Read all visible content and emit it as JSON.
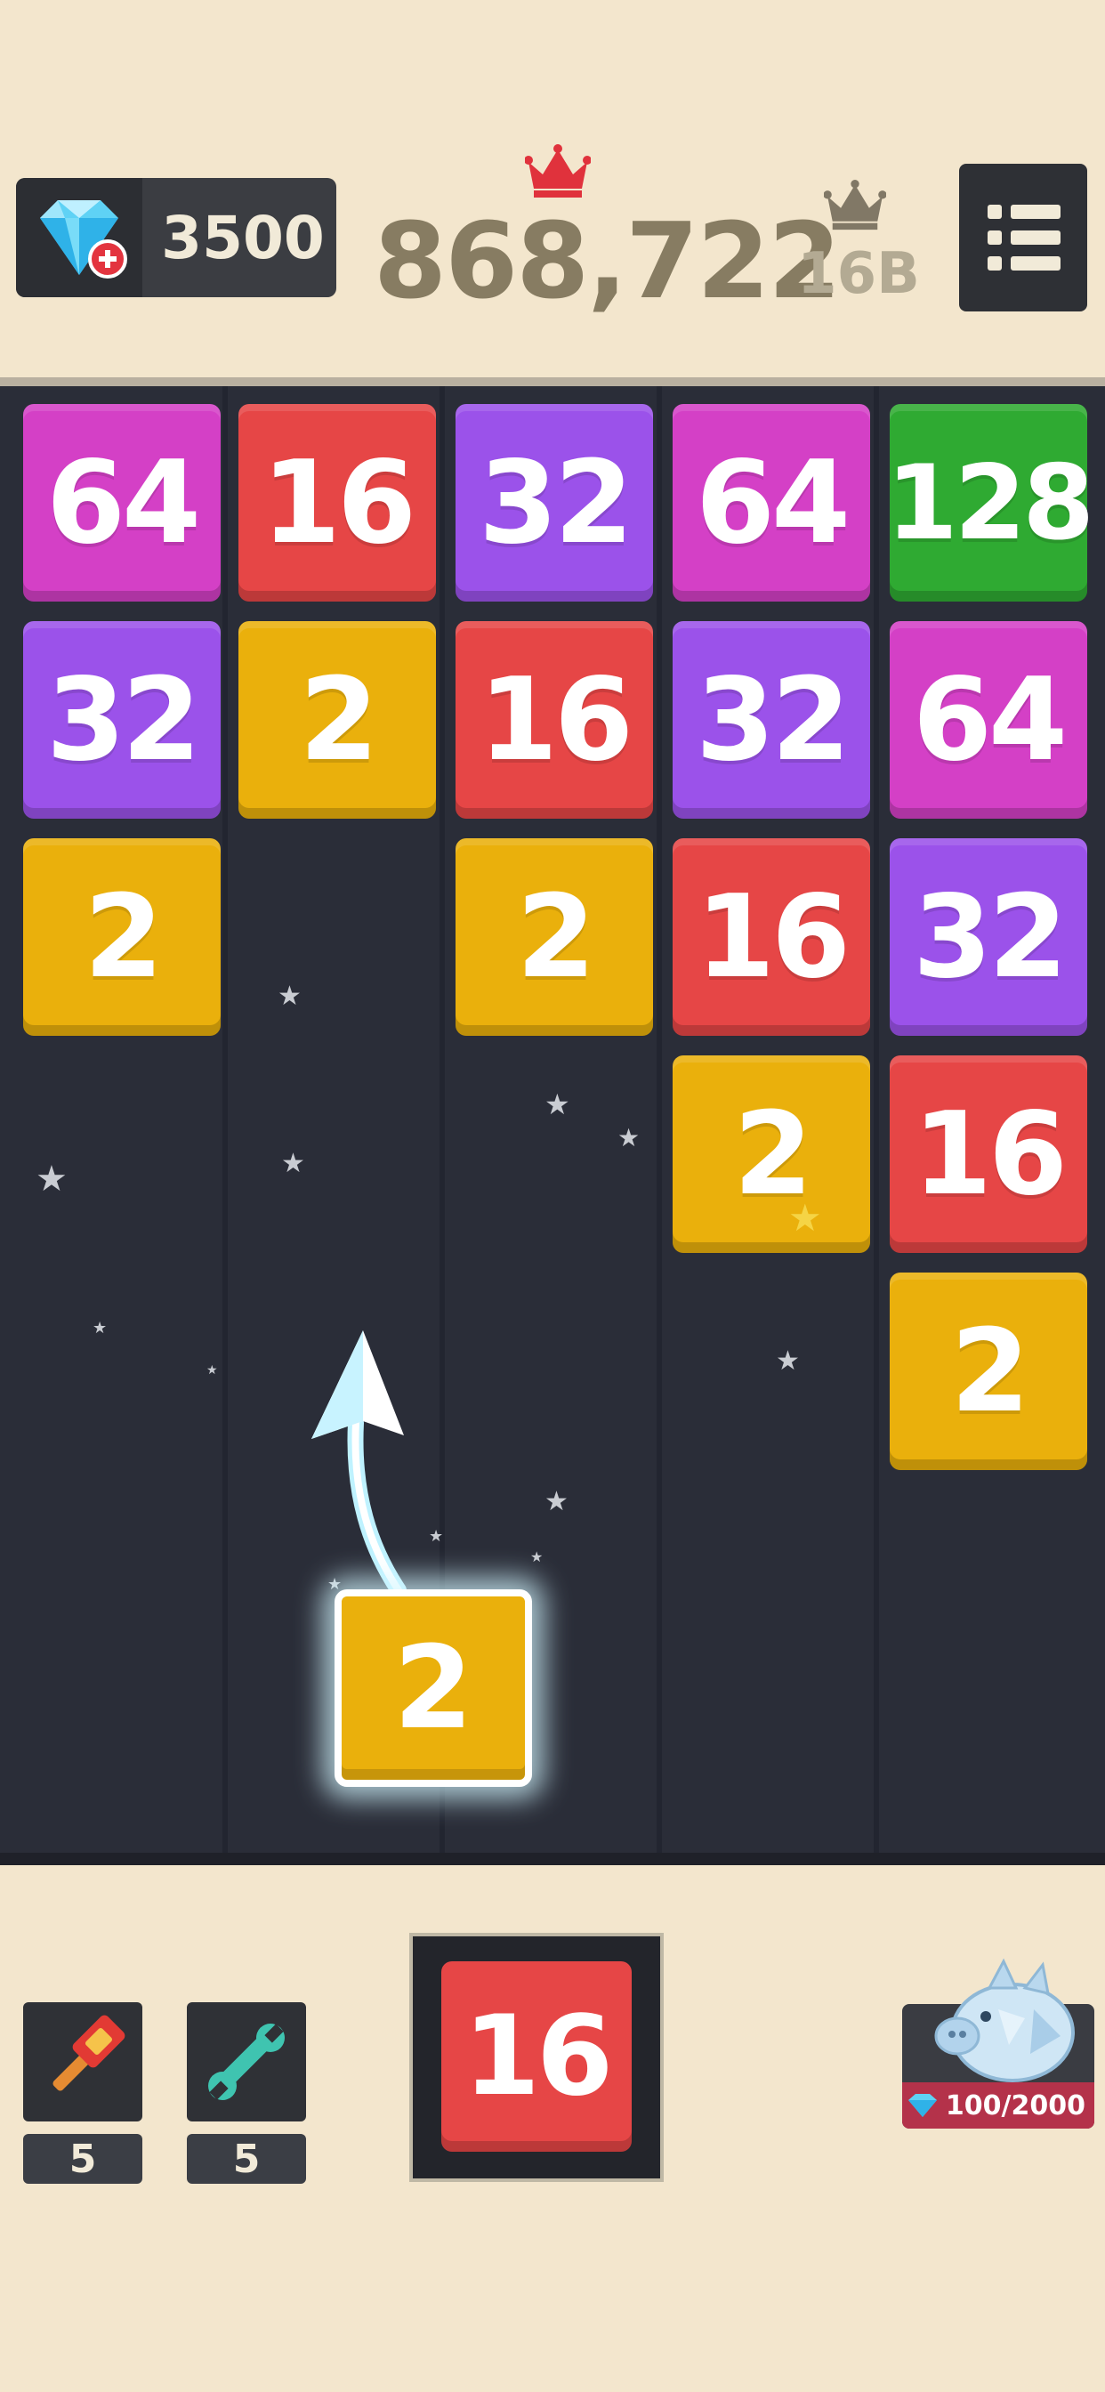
{
  "header": {
    "gems": "3500",
    "score": "868,722",
    "best": "16B"
  },
  "board": {
    "columns": 5,
    "tiles": [
      {
        "col": 0,
        "row": 0,
        "value": "64"
      },
      {
        "col": 1,
        "row": 0,
        "value": "16"
      },
      {
        "col": 2,
        "row": 0,
        "value": "32"
      },
      {
        "col": 3,
        "row": 0,
        "value": "64"
      },
      {
        "col": 4,
        "row": 0,
        "value": "128"
      },
      {
        "col": 0,
        "row": 1,
        "value": "32"
      },
      {
        "col": 1,
        "row": 1,
        "value": "2"
      },
      {
        "col": 2,
        "row": 1,
        "value": "16"
      },
      {
        "col": 3,
        "row": 1,
        "value": "32"
      },
      {
        "col": 4,
        "row": 1,
        "value": "64"
      },
      {
        "col": 0,
        "row": 2,
        "value": "2"
      },
      {
        "col": 2,
        "row": 2,
        "value": "2"
      },
      {
        "col": 3,
        "row": 2,
        "value": "16"
      },
      {
        "col": 4,
        "row": 2,
        "value": "32"
      },
      {
        "col": 3,
        "row": 3,
        "value": "2"
      },
      {
        "col": 4,
        "row": 3,
        "value": "16"
      },
      {
        "col": 4,
        "row": 4,
        "value": "2"
      }
    ],
    "moving_tile": "2"
  },
  "colors": {
    "2": "#eab00c",
    "16": "#e64646",
    "32": "#9b52ea",
    "64": "#d440c6",
    "128": "#2faa32"
  },
  "footer": {
    "hammer_count": "5",
    "wrench_count": "5",
    "next_tile": "16",
    "piggy_progress": "100/2000"
  },
  "icons": [
    "diamond-plus-icon",
    "crown-icon",
    "crown-gray-icon",
    "menu-list-icon",
    "hammer-icon",
    "wrench-icon",
    "piggy-bank-icon",
    "diamond-small-icon"
  ]
}
